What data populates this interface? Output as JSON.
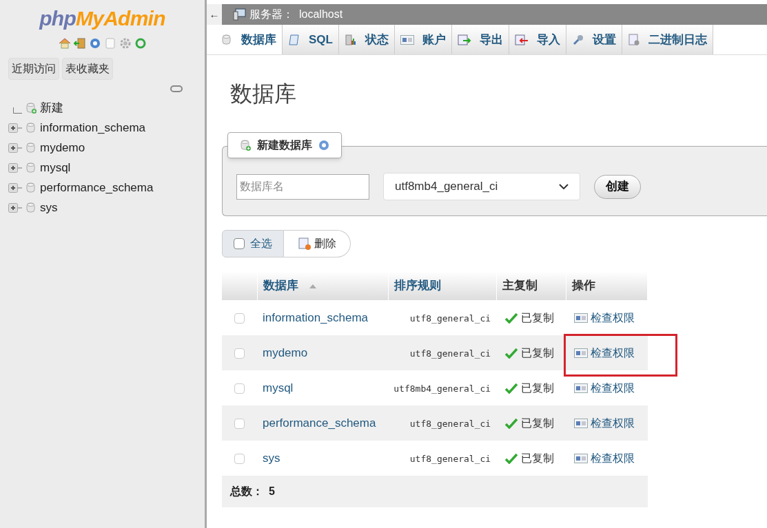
{
  "sidebar": {
    "logo": {
      "part_1": "php",
      "part_2": "MyAdmin"
    },
    "tabs": [
      {
        "label": "近期访问"
      },
      {
        "label": "表收藏夹"
      }
    ],
    "tree": [
      {
        "label": "新建",
        "kind": "new"
      },
      {
        "label": "information_schema",
        "kind": "db"
      },
      {
        "label": "mydemo",
        "kind": "db"
      },
      {
        "label": "mysql",
        "kind": "db"
      },
      {
        "label": "performance_schema",
        "kind": "db"
      },
      {
        "label": "sys",
        "kind": "db"
      }
    ]
  },
  "topbar": {
    "back": "←",
    "label": "服务器：",
    "server": "localhost"
  },
  "tabs": [
    {
      "label": "数据库",
      "selected": true
    },
    {
      "label": "SQL",
      "selected": false
    },
    {
      "label": "状态",
      "selected": false
    },
    {
      "label": "账户",
      "selected": false
    },
    {
      "label": "导出",
      "selected": false
    },
    {
      "label": "导入",
      "selected": false
    },
    {
      "label": "设置",
      "selected": false
    },
    {
      "label": "二进制日志",
      "selected": false
    }
  ],
  "page_title": "数据库",
  "create": {
    "legend": "新建数据库",
    "name_field": {
      "placeholder": "数据库名"
    },
    "collation": "utf8mb4_general_ci",
    "button": "创建"
  },
  "bulk": {
    "select_all": {
      "label": "全选",
      "checked": false
    },
    "delete": "删除"
  },
  "table": {
    "columns": [
      "数据库",
      "排序规则",
      "主复制",
      "操作"
    ],
    "rows": [
      {
        "name": "information_schema",
        "collation": "utf8_general_ci",
        "replication": "已复制",
        "action": "检查权限",
        "checked": false,
        "highlighted": false
      },
      {
        "name": "mydemo",
        "collation": "utf8_general_ci",
        "replication": "已复制",
        "action": "检查权限",
        "checked": false,
        "highlighted": true
      },
      {
        "name": "mysql",
        "collation": "utf8mb4_general_ci",
        "replication": "已复制",
        "action": "检查权限",
        "checked": false,
        "highlighted": false
      },
      {
        "name": "performance_schema",
        "collation": "utf8_general_ci",
        "replication": "已复制",
        "action": "检查权限",
        "checked": false,
        "highlighted": false
      },
      {
        "name": "sys",
        "collation": "utf8_general_ci",
        "replication": "已复制",
        "action": "检查权限",
        "checked": false,
        "highlighted": false
      }
    ],
    "total_label": "总数：",
    "total": "5"
  }
}
